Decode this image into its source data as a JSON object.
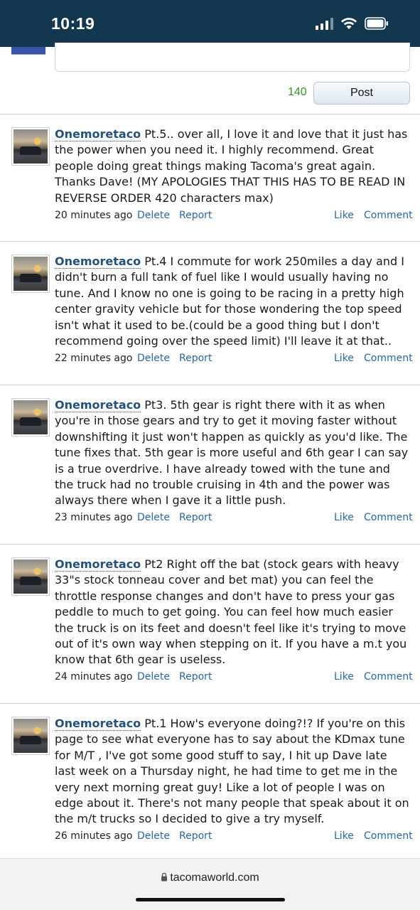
{
  "status": {
    "time": "10:19"
  },
  "composer": {
    "char_count": "140",
    "post_label": "Post"
  },
  "comments": [
    {
      "author": "Onemoretaco",
      "text": "Pt.5.. over all, I love it and love that it just has the power when you need it. I highly recommend. Great people doing great things making Tacoma's great again. Thanks Dave! (MY APOLOGIES THAT THIS HAS TO BE READ IN REVERSE ORDER 420 characters max)",
      "time": "20 minutes ago",
      "delete": "Delete",
      "report": "Report",
      "like": "Like",
      "comment": "Comment"
    },
    {
      "author": "Onemoretaco",
      "text": "Pt.4 I commute for work 250miles a day and I didn't burn a full tank of fuel like I would usually having no tune. And I know no one is going to be racing in a pretty high center gravity vehicle but for those wondering the top speed isn't what it used to be.(could be a good thing but I don't recommend going over the speed limit) I'll leave it at that..",
      "time": "22 minutes ago",
      "delete": "Delete",
      "report": "Report",
      "like": "Like",
      "comment": "Comment"
    },
    {
      "author": "Onemoretaco",
      "text": "Pt3. 5th gear is right there with it as when you're in those gears and try to get it moving faster without downshifting it just won't happen as quickly as you'd like. The tune fixes that. 5th gear is more useful and 6th gear I can say is a true overdrive. I have already towed with the tune and the truck had no trouble cruising in 4th and the power was always there when I gave it a little push.",
      "time": "23 minutes ago",
      "delete": "Delete",
      "report": "Report",
      "like": "Like",
      "comment": "Comment"
    },
    {
      "author": "Onemoretaco",
      "text": "Pt2 Right off the bat (stock gears with heavy 33\"s stock tonneau cover and bet mat) you can feel the throttle response changes and don't have to press your gas peddle to much to get going. You can feel how much easier the truck is on its feet and doesn't feel like it's trying to move out of it's own way when stepping on it. If you have a m.t you know that 6th gear is useless.",
      "time": "24 minutes ago",
      "delete": "Delete",
      "report": "Report",
      "like": "Like",
      "comment": "Comment"
    },
    {
      "author": "Onemoretaco",
      "text": "Pt.1 How's everyone doing?!? If you're on this page to see what everyone has to say about the KDmax tune for M/T , I've got some good stuff to say, I hit up Dave late last week on a Thursday night, he had time to get me in the very next morning great guy! Like a lot of people I was on edge about it. There's not many people that speak about it on the m/t trucks so I decided to give a try myself.",
      "time": "26 minutes ago",
      "delete": "Delete",
      "report": "Report",
      "like": "Like",
      "comment": "Comment"
    }
  ],
  "browser": {
    "url": "tacomaworld.com"
  }
}
